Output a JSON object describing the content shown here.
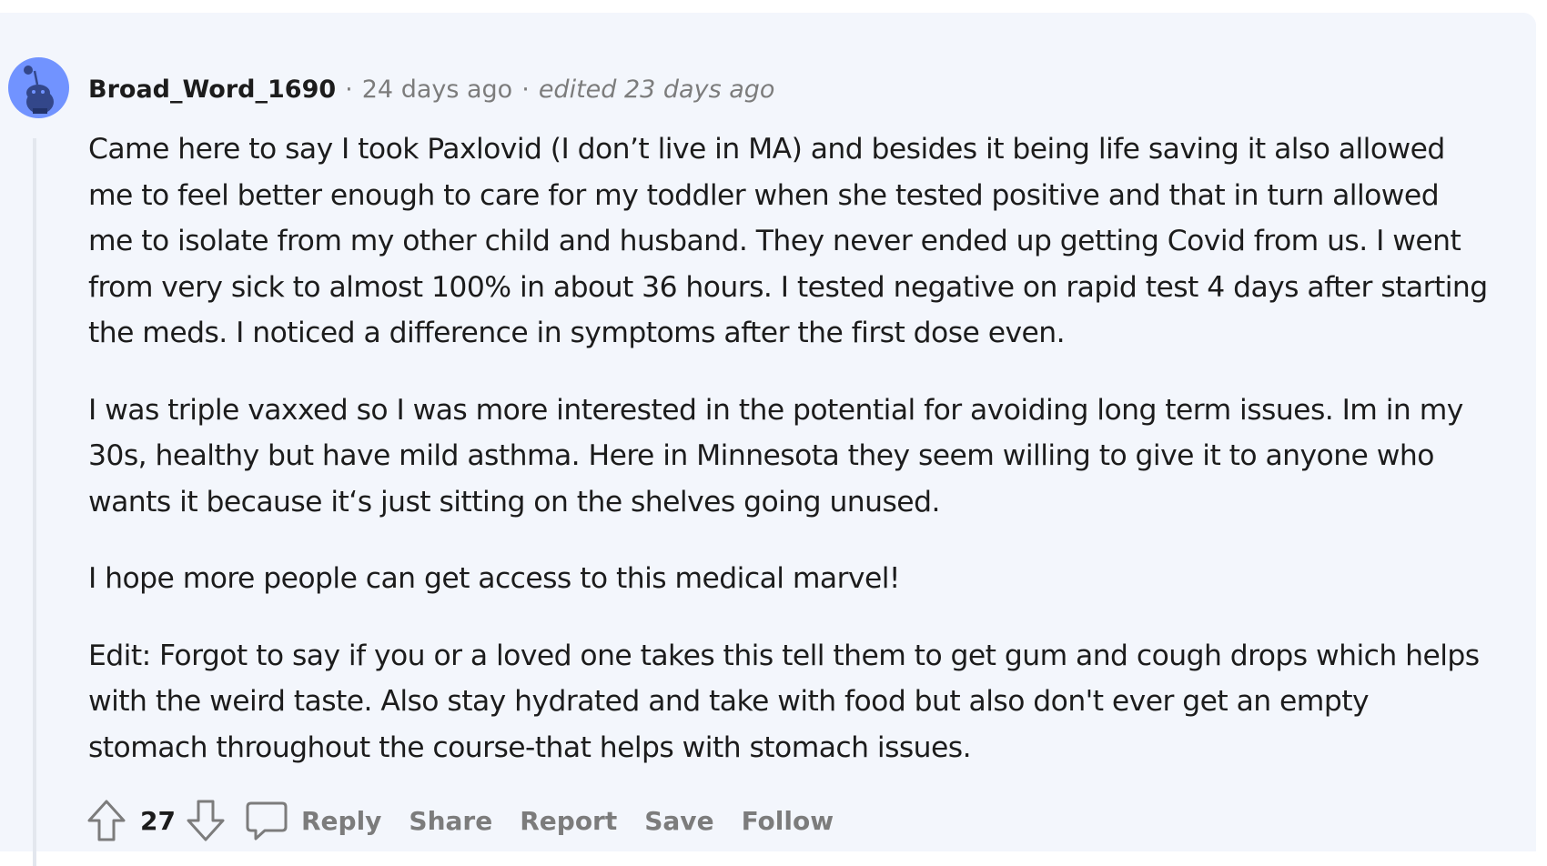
{
  "comment": {
    "author": "Broad_Word_1690",
    "separator": "·",
    "posted": "24 days ago",
    "edited": "edited 23 days ago",
    "paragraphs": [
      [
        "Came here to say I took Paxlovid (I don’t live in MA) and besides it being life saving it also allowed",
        "me to feel better enough to care for my toddler when she tested positive and that in turn allowed",
        "me to isolate from my other child and husband. They never ended up getting Covid from us. I went",
        "from very sick to almost 100% in about 36 hours. I tested negative on rapid test 4 days after starting",
        "the meds. I noticed a difference in symptoms after the first dose even."
      ],
      [
        "I was triple vaxxed so I was more interested in the potential for avoiding long term issues. Im in my",
        "30s, healthy but have mild asthma. Here in Minnesota they seem willing to give it to anyone who",
        "wants it because it‘s just sitting on the shelves going unused."
      ],
      [
        "I hope more people can get access to this medical marvel!"
      ],
      [
        "Edit: Forgot to say if you or a loved one takes this tell them to get gum and cough drops which helps",
        "with the weird taste. Also stay hydrated and take with food but also don't ever get an empty",
        "stomach throughout the course-that helps with stomach issues."
      ]
    ]
  },
  "actions": {
    "score": "27",
    "reply": "Reply",
    "share": "Share",
    "report": "Report",
    "save": "Save",
    "follow": "Follow"
  },
  "icons": {
    "avatar": "snoo-avatar-icon",
    "upvote": "arrow-up-icon",
    "downvote": "arrow-down-icon",
    "reply": "speech-bubble-icon"
  },
  "colors": {
    "background": "#f3f6fc",
    "avatar": "#7193ff",
    "text": "#1c1c1c",
    "muted": "#7c7c7c",
    "thread_line": "#e3e7ee"
  }
}
